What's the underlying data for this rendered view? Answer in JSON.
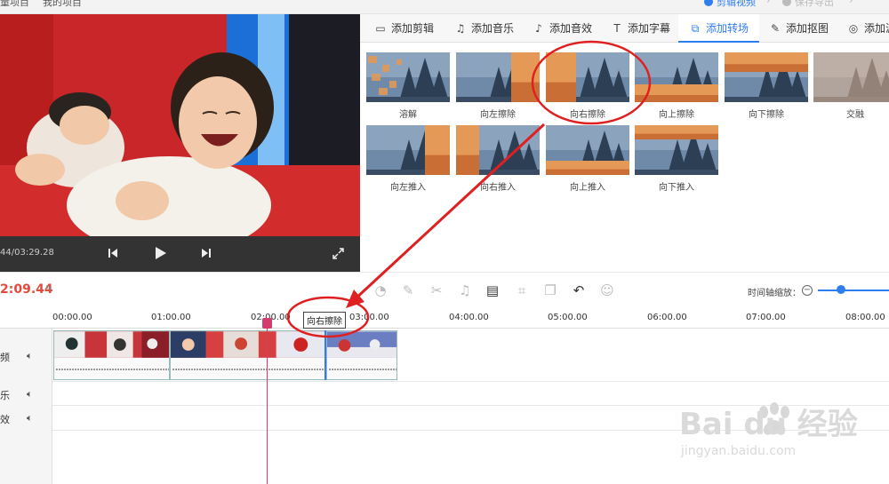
{
  "topbar": {
    "left_items": [
      "量项目",
      "我的项目"
    ],
    "steps": [
      {
        "label": "剪辑视频",
        "active": true
      },
      {
        "label": "保存导出",
        "active": false
      }
    ]
  },
  "player": {
    "time": "44/03:29.28",
    "icons": [
      "skip-previous-icon",
      "play-icon",
      "skip-next-icon",
      "fullscreen-icon"
    ]
  },
  "tabs": [
    {
      "label": "添加剪辑",
      "icon": "clip-icon",
      "active": false
    },
    {
      "label": "添加音乐",
      "icon": "music-icon",
      "active": false
    },
    {
      "label": "添加音效",
      "icon": "sound-effect-icon",
      "active": false
    },
    {
      "label": "添加字幕",
      "icon": "text-icon",
      "active": false
    },
    {
      "label": "添加转场",
      "icon": "transition-icon",
      "active": true
    },
    {
      "label": "添加抠图",
      "icon": "cutout-icon",
      "active": false
    },
    {
      "label": "添加滤",
      "icon": "filter-icon",
      "active": false
    }
  ],
  "transitions": [
    {
      "label": "溶解",
      "variant": "dissolve"
    },
    {
      "label": "向左擦除",
      "variant": "wipe-left"
    },
    {
      "label": "向右擦除",
      "variant": "wipe-right"
    },
    {
      "label": "向上擦除",
      "variant": "wipe-up"
    },
    {
      "label": "向下擦除",
      "variant": "wipe-down"
    },
    {
      "label": "交融",
      "variant": "blend"
    },
    {
      "label": "向左推入",
      "variant": "push-left"
    },
    {
      "label": "向右推入",
      "variant": "push-right"
    },
    {
      "label": "向上推入",
      "variant": "push-up"
    },
    {
      "label": "向下推入",
      "variant": "push-down"
    }
  ],
  "timeline": {
    "current_time": "2:09.44",
    "zoom_label": "时间轴缩放：",
    "zoom_level": 0.33,
    "ruler": [
      "00:00.00",
      "01:00.00",
      "02:00.00",
      "03:00.00",
      "04:00.00",
      "05:00.00",
      "06:00.00",
      "07:00.00",
      "08:00.00"
    ],
    "tracks": [
      {
        "label": "频",
        "icon": "speaker-icon"
      },
      {
        "label": "乐",
        "icon": "speaker-icon"
      },
      {
        "label": "效",
        "icon": "speaker-icon"
      }
    ],
    "tooltip": "向右擦除",
    "tools": [
      "speed-icon",
      "pen-icon",
      "scissors-icon",
      "bell-icon",
      "delete-icon",
      "crop-icon",
      "copy-icon",
      "undo-icon",
      "smile-icon"
    ]
  },
  "watermark": {
    "brand": "Bai du 经验",
    "url": "jingyan.baidu.com"
  },
  "colors": {
    "accent": "#2f7ef0",
    "time_red": "#e24a3c",
    "playhead": "#d33c6b",
    "annotation": "#e02020"
  }
}
